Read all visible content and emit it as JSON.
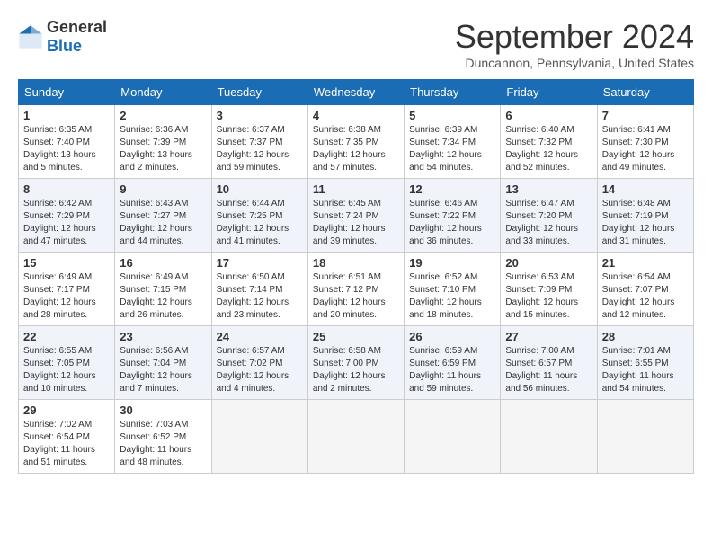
{
  "logo": {
    "general": "General",
    "blue": "Blue"
  },
  "title": "September 2024",
  "location": "Duncannon, Pennsylvania, United States",
  "days_of_week": [
    "Sunday",
    "Monday",
    "Tuesday",
    "Wednesday",
    "Thursday",
    "Friday",
    "Saturday"
  ],
  "weeks": [
    [
      {
        "day": "1",
        "info": "Sunrise: 6:35 AM\nSunset: 7:40 PM\nDaylight: 13 hours\nand 5 minutes."
      },
      {
        "day": "2",
        "info": "Sunrise: 6:36 AM\nSunset: 7:39 PM\nDaylight: 13 hours\nand 2 minutes."
      },
      {
        "day": "3",
        "info": "Sunrise: 6:37 AM\nSunset: 7:37 PM\nDaylight: 12 hours\nand 59 minutes."
      },
      {
        "day": "4",
        "info": "Sunrise: 6:38 AM\nSunset: 7:35 PM\nDaylight: 12 hours\nand 57 minutes."
      },
      {
        "day": "5",
        "info": "Sunrise: 6:39 AM\nSunset: 7:34 PM\nDaylight: 12 hours\nand 54 minutes."
      },
      {
        "day": "6",
        "info": "Sunrise: 6:40 AM\nSunset: 7:32 PM\nDaylight: 12 hours\nand 52 minutes."
      },
      {
        "day": "7",
        "info": "Sunrise: 6:41 AM\nSunset: 7:30 PM\nDaylight: 12 hours\nand 49 minutes."
      }
    ],
    [
      {
        "day": "8",
        "info": "Sunrise: 6:42 AM\nSunset: 7:29 PM\nDaylight: 12 hours\nand 47 minutes."
      },
      {
        "day": "9",
        "info": "Sunrise: 6:43 AM\nSunset: 7:27 PM\nDaylight: 12 hours\nand 44 minutes."
      },
      {
        "day": "10",
        "info": "Sunrise: 6:44 AM\nSunset: 7:25 PM\nDaylight: 12 hours\nand 41 minutes."
      },
      {
        "day": "11",
        "info": "Sunrise: 6:45 AM\nSunset: 7:24 PM\nDaylight: 12 hours\nand 39 minutes."
      },
      {
        "day": "12",
        "info": "Sunrise: 6:46 AM\nSunset: 7:22 PM\nDaylight: 12 hours\nand 36 minutes."
      },
      {
        "day": "13",
        "info": "Sunrise: 6:47 AM\nSunset: 7:20 PM\nDaylight: 12 hours\nand 33 minutes."
      },
      {
        "day": "14",
        "info": "Sunrise: 6:48 AM\nSunset: 7:19 PM\nDaylight: 12 hours\nand 31 minutes."
      }
    ],
    [
      {
        "day": "15",
        "info": "Sunrise: 6:49 AM\nSunset: 7:17 PM\nDaylight: 12 hours\nand 28 minutes."
      },
      {
        "day": "16",
        "info": "Sunrise: 6:49 AM\nSunset: 7:15 PM\nDaylight: 12 hours\nand 26 minutes."
      },
      {
        "day": "17",
        "info": "Sunrise: 6:50 AM\nSunset: 7:14 PM\nDaylight: 12 hours\nand 23 minutes."
      },
      {
        "day": "18",
        "info": "Sunrise: 6:51 AM\nSunset: 7:12 PM\nDaylight: 12 hours\nand 20 minutes."
      },
      {
        "day": "19",
        "info": "Sunrise: 6:52 AM\nSunset: 7:10 PM\nDaylight: 12 hours\nand 18 minutes."
      },
      {
        "day": "20",
        "info": "Sunrise: 6:53 AM\nSunset: 7:09 PM\nDaylight: 12 hours\nand 15 minutes."
      },
      {
        "day": "21",
        "info": "Sunrise: 6:54 AM\nSunset: 7:07 PM\nDaylight: 12 hours\nand 12 minutes."
      }
    ],
    [
      {
        "day": "22",
        "info": "Sunrise: 6:55 AM\nSunset: 7:05 PM\nDaylight: 12 hours\nand 10 minutes."
      },
      {
        "day": "23",
        "info": "Sunrise: 6:56 AM\nSunset: 7:04 PM\nDaylight: 12 hours\nand 7 minutes."
      },
      {
        "day": "24",
        "info": "Sunrise: 6:57 AM\nSunset: 7:02 PM\nDaylight: 12 hours\nand 4 minutes."
      },
      {
        "day": "25",
        "info": "Sunrise: 6:58 AM\nSunset: 7:00 PM\nDaylight: 12 hours\nand 2 minutes."
      },
      {
        "day": "26",
        "info": "Sunrise: 6:59 AM\nSunset: 6:59 PM\nDaylight: 11 hours\nand 59 minutes."
      },
      {
        "day": "27",
        "info": "Sunrise: 7:00 AM\nSunset: 6:57 PM\nDaylight: 11 hours\nand 56 minutes."
      },
      {
        "day": "28",
        "info": "Sunrise: 7:01 AM\nSunset: 6:55 PM\nDaylight: 11 hours\nand 54 minutes."
      }
    ],
    [
      {
        "day": "29",
        "info": "Sunrise: 7:02 AM\nSunset: 6:54 PM\nDaylight: 11 hours\nand 51 minutes."
      },
      {
        "day": "30",
        "info": "Sunrise: 7:03 AM\nSunset: 6:52 PM\nDaylight: 11 hours\nand 48 minutes."
      },
      {
        "day": "",
        "info": ""
      },
      {
        "day": "",
        "info": ""
      },
      {
        "day": "",
        "info": ""
      },
      {
        "day": "",
        "info": ""
      },
      {
        "day": "",
        "info": ""
      }
    ]
  ]
}
